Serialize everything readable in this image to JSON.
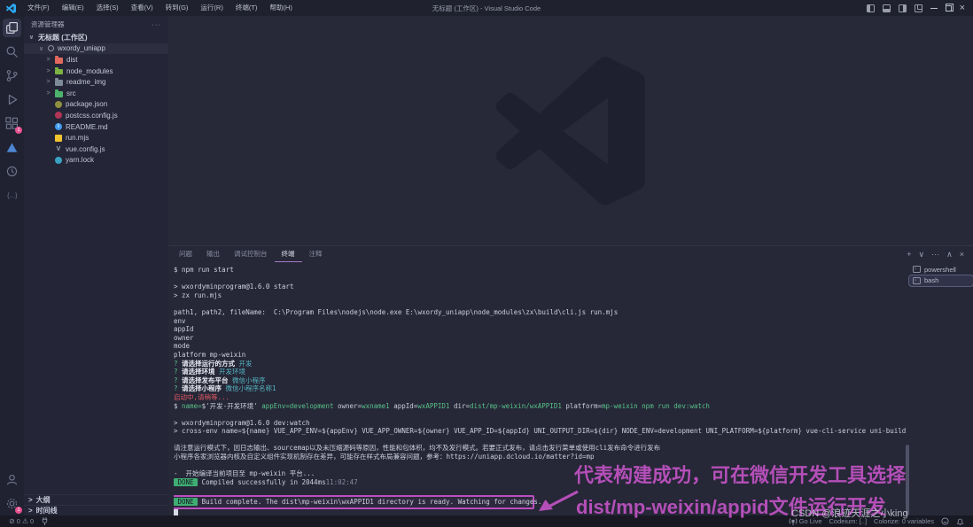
{
  "titlebar": {
    "menus": [
      "文件(F)",
      "编辑(E)",
      "选择(S)",
      "查看(V)",
      "转到(G)",
      "运行(R)",
      "终端(T)",
      "帮助(H)"
    ],
    "title": "无标题 (工作区) - Visual Studio Code",
    "logo_color": "#2aa9f2"
  },
  "activity_bar": {
    "extensions_badge": "1",
    "settings_badge": "1",
    "triangle_color": "#4e86d2"
  },
  "sidebar": {
    "header": "资源管理器",
    "more_label": "···",
    "workspace": "无标题 (工作区)",
    "root": "wxordy_uniapp",
    "items": [
      {
        "label": "dist"
      },
      {
        "label": "node_modules"
      },
      {
        "label": "readme_img"
      },
      {
        "label": "src"
      },
      {
        "label": "package.json"
      },
      {
        "label": "postcss.config.js"
      },
      {
        "label": "README.md"
      },
      {
        "label": "run.mjs"
      },
      {
        "label": "vue.config.js"
      },
      {
        "label": "yarn.lock"
      }
    ],
    "outline": "大纲",
    "timeline": "时间线"
  },
  "panel": {
    "tabs": [
      {
        "label": "问题"
      },
      {
        "label": "输出"
      },
      {
        "label": "调试控制台"
      },
      {
        "label": "终端"
      },
      {
        "label": "注释"
      }
    ],
    "active_tab": "终端",
    "actions": {
      "new": "+",
      "dropdown": "∨",
      "more": "···",
      "maximize": "∧",
      "close": "×"
    },
    "terminals": [
      {
        "label": "powershell"
      },
      {
        "label": "bash"
      }
    ],
    "terminal_lines": [
      {
        "segs": [
          {
            "t": "$ npm run start",
            "c": "w"
          }
        ]
      },
      {
        "segs": []
      },
      {
        "segs": [
          {
            "t": "> wxordyminprogram@1.6.0 start",
            "c": "w"
          }
        ]
      },
      {
        "segs": [
          {
            "t": "> zx run.mjs",
            "c": "w"
          }
        ]
      },
      {
        "segs": []
      },
      {
        "segs": [
          {
            "t": "path1, path2, fileName:  C:\\Program Files\\nodejs\\node.exe E:\\wxordy_uniapp\\node_modules\\zx\\build\\cli.js run.mjs",
            "c": "w"
          }
        ]
      },
      {
        "segs": [
          {
            "t": "env",
            "c": "w"
          }
        ]
      },
      {
        "segs": [
          {
            "t": "appId",
            "c": "w"
          }
        ]
      },
      {
        "segs": [
          {
            "t": "owner",
            "c": "w"
          }
        ]
      },
      {
        "segs": [
          {
            "t": "mode",
            "c": "w"
          }
        ]
      },
      {
        "segs": [
          {
            "t": "platform mp-weixin",
            "c": "w"
          }
        ]
      },
      {
        "segs": [
          {
            "t": "? ",
            "c": "g"
          },
          {
            "t": "请选择运行的方式 ",
            "c": "b"
          },
          {
            "t": "开发",
            "c": "t"
          }
        ]
      },
      {
        "segs": [
          {
            "t": "? ",
            "c": "g"
          },
          {
            "t": "请选择环境 ",
            "c": "b"
          },
          {
            "t": "开发环境",
            "c": "t"
          }
        ]
      },
      {
        "segs": [
          {
            "t": "? ",
            "c": "g"
          },
          {
            "t": "请选择发布平台 ",
            "c": "b"
          },
          {
            "t": "微信小程序",
            "c": "t"
          }
        ]
      },
      {
        "segs": [
          {
            "t": "? ",
            "c": "g"
          },
          {
            "t": "请选择小程序 ",
            "c": "b"
          },
          {
            "t": "微信小程序名称1",
            "c": "t"
          }
        ]
      },
      {
        "segs": [
          {
            "t": "启动中,请稍等...",
            "c": "r"
          }
        ]
      },
      {
        "segs": [
          {
            "t": "$ ",
            "c": "w"
          },
          {
            "t": "name=",
            "c": "g"
          },
          {
            "t": "$'开发-开发环境' ",
            "c": "w"
          },
          {
            "t": "appEnv=development ",
            "c": "g"
          },
          {
            "t": "owner=",
            "c": "w"
          },
          {
            "t": "wxname1 ",
            "c": "g"
          },
          {
            "t": "appId=",
            "c": "w"
          },
          {
            "t": "wxAPPID1 ",
            "c": "g"
          },
          {
            "t": "dir=",
            "c": "w"
          },
          {
            "t": "dist/mp-weixin/wxAPPID1 ",
            "c": "g"
          },
          {
            "t": "platform=",
            "c": "w"
          },
          {
            "t": "mp-weixin ",
            "c": "g"
          },
          {
            "t": "npm run dev:watch",
            "c": "g"
          }
        ]
      },
      {
        "segs": []
      },
      {
        "segs": [
          {
            "t": "> wxordyminprogram@1.6.0 dev:watch",
            "c": "w"
          }
        ]
      },
      {
        "segs": [
          {
            "t": "> cross-env name=${name} VUE_APP_ENV=${appEnv} VUE_APP_OWNER=${owner} VUE_APP_ID=${appId} UNI_OUTPUT_DIR=${dir} NODE_ENV=development UNI_PLATFORM=${platform} vue-cli-service uni-build --watch",
            "c": "w"
          }
        ]
      },
      {
        "segs": []
      },
      {
        "segs": [
          {
            "t": "请注意运行模式下，因日志输出、sourcemap以及未压缩源码等原因，性能和包体积，均不及发行模式。若要正式发布，请点击发行菜单或使用cli发布命令进行发布",
            "c": "w"
          }
        ]
      },
      {
        "segs": [
          {
            "t": "小程序各家浏览器内核及自定义组件实现机制存在差异，可能存在样式布局兼容问题，参考：https://uniapp.dcloud.io/matter?id=mp",
            "c": "w"
          }
        ]
      },
      {
        "segs": []
      },
      {
        "segs": [
          {
            "t": "-  开始编译当前项目至 mp-weixin 平台...",
            "c": "w"
          }
        ]
      },
      {
        "segs": [
          {
            "t": " DONE ",
            "c": "badge"
          },
          {
            "t": " Compiled successfully in 2044ms",
            "c": "w"
          },
          {
            "t": "11:02:47",
            "c": "dim"
          }
        ]
      },
      {
        "segs": []
      },
      {
        "box": true,
        "segs": [
          {
            "t": " DONE ",
            "c": "badge"
          },
          {
            "t": " Build complete. The dist\\mp-weixin\\wxAPPID1 directory is ready. Watching for changes...",
            "c": "w"
          }
        ]
      },
      {
        "cursor": true,
        "segs": []
      }
    ]
  },
  "annotation": {
    "line1": "代表构建成功，可在微信开发工具选择",
    "line2": "dist/mp-weixin/appid文件运行开发",
    "color": "#b44fb8"
  },
  "watermark": "CSDN @浪迹天涯之小king",
  "statusbar": {
    "errors": "0",
    "warnings": "0",
    "go_live": "Go Live",
    "codeium": "Codeium: [..]",
    "colorize": "Colorize: 0 variables"
  },
  "colors": {
    "highlight_box": "#bb4fbe",
    "done_badge": "#3fae73",
    "prompt_green": "#59c389",
    "answer_teal": "#56b6c2",
    "error_red": "#de5a64",
    "badge_pink": "#e4538f",
    "tab_underline": "#a678c8"
  }
}
